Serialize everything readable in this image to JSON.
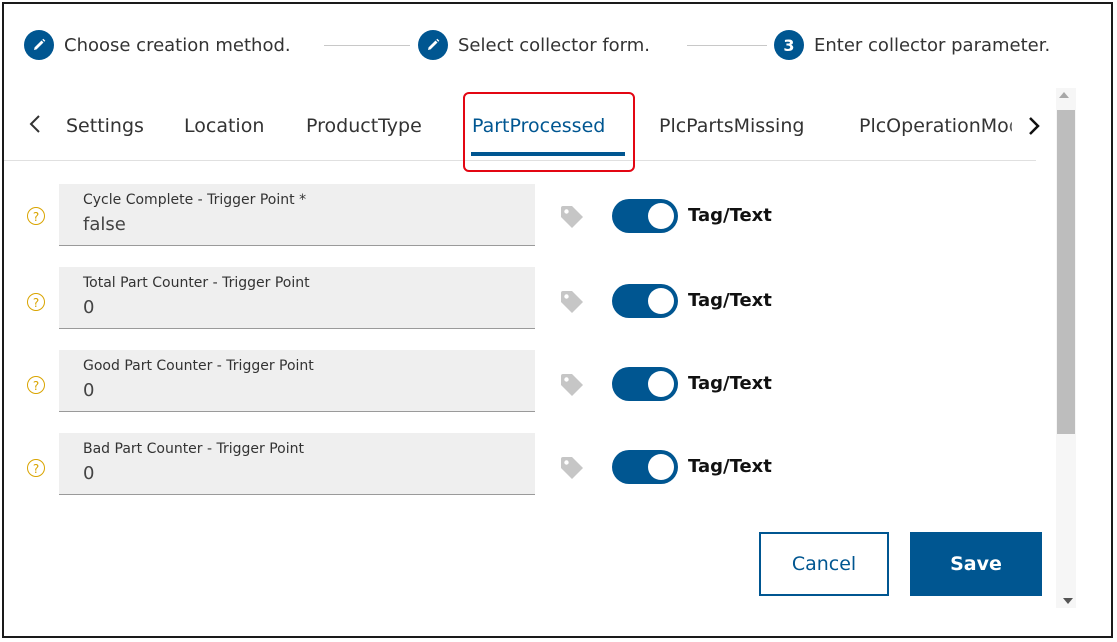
{
  "stepper": {
    "steps": [
      {
        "label": "Choose creation method.",
        "status": "done",
        "icon": "pencil-icon"
      },
      {
        "label": "Select collector form.",
        "status": "done",
        "icon": "pencil-icon"
      },
      {
        "number": "3",
        "label": "Enter collector parameter.",
        "status": "current"
      }
    ]
  },
  "tabs": {
    "items": [
      "Settings",
      "Location",
      "ProductType",
      "PartProcessed",
      "PlcPartsMissing",
      "PlcOperationMode"
    ],
    "active": "PartProcessed",
    "prev_icon": "chevron-left-icon",
    "next_icon": "chevron-right-icon"
  },
  "fields": [
    {
      "label": "Cycle Complete - Trigger Point *",
      "value": "false",
      "toggle_label": "Tag/Text",
      "toggle_on": true
    },
    {
      "label": "Total Part Counter - Trigger Point",
      "value": "0",
      "toggle_label": "Tag/Text",
      "toggle_on": true
    },
    {
      "label": "Good Part Counter - Trigger Point",
      "value": "0",
      "toggle_label": "Tag/Text",
      "toggle_on": true
    },
    {
      "label": "Bad Part Counter - Trigger Point",
      "value": "0",
      "toggle_label": "Tag/Text",
      "toggle_on": true
    }
  ],
  "help_icon": "?",
  "buttons": {
    "cancel": "Cancel",
    "save": "Save"
  },
  "colors": {
    "primary": "#005691",
    "highlight": "#e30613",
    "help": "#d9a400",
    "field_bg": "#efefef"
  }
}
